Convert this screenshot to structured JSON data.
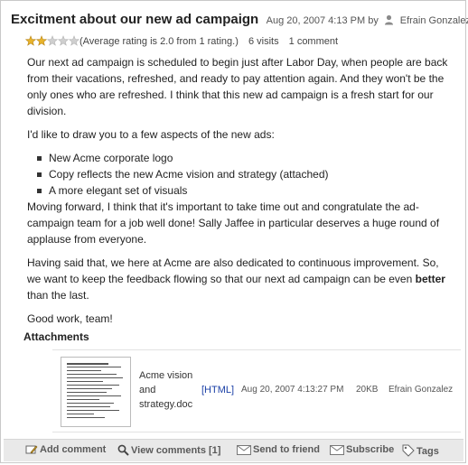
{
  "post": {
    "title": "Excitment about our new ad campaign",
    "date": "Aug 20, 2007 4:13 PM by",
    "author": "Efrain Gonzalez",
    "rating_value": 2,
    "rating_max": 5,
    "rating_text": "(Average rating is 2.0 from 1 rating.)",
    "visits": "6 visits",
    "comments": "1 comment"
  },
  "body": {
    "p1": "Our next ad campaign is scheduled to begin just after Labor Day, when people are back from their vacations, refreshed, and ready to pay attention again. And they won't be the only ones who are refreshed. I think that this new ad campaign is a fresh start for our division.",
    "p2": "I'd like to draw you to a few aspects of the new ads:",
    "bullets": [
      "New Acme corporate logo",
      "Copy reflects the new Acme vision and strategy (attached)",
      "A more elegant set of visuals"
    ],
    "p3": "Moving forward, I think that it's important to take time out and congratulate the ad-campaign team for a job well done! Sally Jaffee in particular deserves a huge round of applause from everyone.",
    "p4_before": "Having said that, we here at Acme are also dedicated to continuous improvement. So, we want to keep the feedback flowing so that our next ad campaign can be even ",
    "p4_bold": "better",
    "p4_after": " than the last.",
    "p5": "Good work, team!"
  },
  "attachments": {
    "title": "Attachments",
    "items": [
      {
        "name": "Acme vision and strategy.doc",
        "type": "[HTML]",
        "date": "Aug 20, 2007 4:13:27 PM",
        "size": "20KB",
        "author": "Efrain Gonzalez"
      }
    ]
  },
  "toolbar": {
    "add_comment": "Add comment",
    "view_comments": "View comments [1]",
    "send_to_friend": "Send to friend",
    "subscribe": "Subscribe",
    "tags": "Tags"
  },
  "colors": {
    "star_filled": "#e8b32a",
    "star_empty": "#cfcfcf",
    "link": "#1a3fa6",
    "toolbar_bg": "#e9e9e9"
  }
}
